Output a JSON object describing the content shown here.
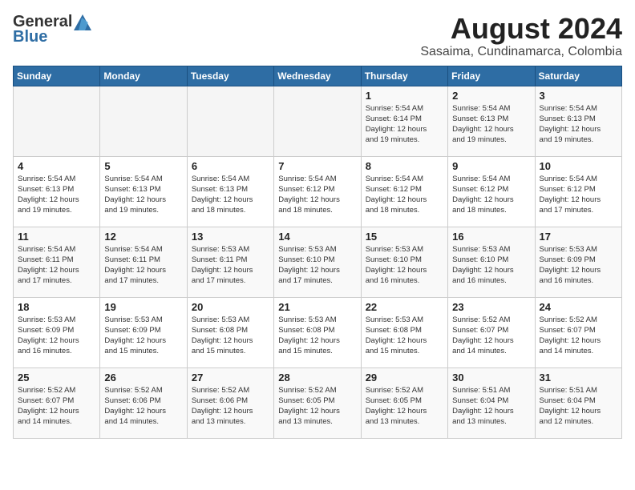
{
  "header": {
    "logo_line1": "General",
    "logo_line2": "Blue",
    "title": "August 2024",
    "subtitle": "Sasaima, Cundinamarca, Colombia"
  },
  "weekdays": [
    "Sunday",
    "Monday",
    "Tuesday",
    "Wednesday",
    "Thursday",
    "Friday",
    "Saturday"
  ],
  "weeks": [
    [
      {
        "day": "",
        "info": ""
      },
      {
        "day": "",
        "info": ""
      },
      {
        "day": "",
        "info": ""
      },
      {
        "day": "",
        "info": ""
      },
      {
        "day": "1",
        "info": "Sunrise: 5:54 AM\nSunset: 6:14 PM\nDaylight: 12 hours\nand 19 minutes."
      },
      {
        "day": "2",
        "info": "Sunrise: 5:54 AM\nSunset: 6:13 PM\nDaylight: 12 hours\nand 19 minutes."
      },
      {
        "day": "3",
        "info": "Sunrise: 5:54 AM\nSunset: 6:13 PM\nDaylight: 12 hours\nand 19 minutes."
      }
    ],
    [
      {
        "day": "4",
        "info": "Sunrise: 5:54 AM\nSunset: 6:13 PM\nDaylight: 12 hours\nand 19 minutes."
      },
      {
        "day": "5",
        "info": "Sunrise: 5:54 AM\nSunset: 6:13 PM\nDaylight: 12 hours\nand 19 minutes."
      },
      {
        "day": "6",
        "info": "Sunrise: 5:54 AM\nSunset: 6:13 PM\nDaylight: 12 hours\nand 18 minutes."
      },
      {
        "day": "7",
        "info": "Sunrise: 5:54 AM\nSunset: 6:12 PM\nDaylight: 12 hours\nand 18 minutes."
      },
      {
        "day": "8",
        "info": "Sunrise: 5:54 AM\nSunset: 6:12 PM\nDaylight: 12 hours\nand 18 minutes."
      },
      {
        "day": "9",
        "info": "Sunrise: 5:54 AM\nSunset: 6:12 PM\nDaylight: 12 hours\nand 18 minutes."
      },
      {
        "day": "10",
        "info": "Sunrise: 5:54 AM\nSunset: 6:12 PM\nDaylight: 12 hours\nand 17 minutes."
      }
    ],
    [
      {
        "day": "11",
        "info": "Sunrise: 5:54 AM\nSunset: 6:11 PM\nDaylight: 12 hours\nand 17 minutes."
      },
      {
        "day": "12",
        "info": "Sunrise: 5:54 AM\nSunset: 6:11 PM\nDaylight: 12 hours\nand 17 minutes."
      },
      {
        "day": "13",
        "info": "Sunrise: 5:53 AM\nSunset: 6:11 PM\nDaylight: 12 hours\nand 17 minutes."
      },
      {
        "day": "14",
        "info": "Sunrise: 5:53 AM\nSunset: 6:10 PM\nDaylight: 12 hours\nand 17 minutes."
      },
      {
        "day": "15",
        "info": "Sunrise: 5:53 AM\nSunset: 6:10 PM\nDaylight: 12 hours\nand 16 minutes."
      },
      {
        "day": "16",
        "info": "Sunrise: 5:53 AM\nSunset: 6:10 PM\nDaylight: 12 hours\nand 16 minutes."
      },
      {
        "day": "17",
        "info": "Sunrise: 5:53 AM\nSunset: 6:09 PM\nDaylight: 12 hours\nand 16 minutes."
      }
    ],
    [
      {
        "day": "18",
        "info": "Sunrise: 5:53 AM\nSunset: 6:09 PM\nDaylight: 12 hours\nand 16 minutes."
      },
      {
        "day": "19",
        "info": "Sunrise: 5:53 AM\nSunset: 6:09 PM\nDaylight: 12 hours\nand 15 minutes."
      },
      {
        "day": "20",
        "info": "Sunrise: 5:53 AM\nSunset: 6:08 PM\nDaylight: 12 hours\nand 15 minutes."
      },
      {
        "day": "21",
        "info": "Sunrise: 5:53 AM\nSunset: 6:08 PM\nDaylight: 12 hours\nand 15 minutes."
      },
      {
        "day": "22",
        "info": "Sunrise: 5:53 AM\nSunset: 6:08 PM\nDaylight: 12 hours\nand 15 minutes."
      },
      {
        "day": "23",
        "info": "Sunrise: 5:52 AM\nSunset: 6:07 PM\nDaylight: 12 hours\nand 14 minutes."
      },
      {
        "day": "24",
        "info": "Sunrise: 5:52 AM\nSunset: 6:07 PM\nDaylight: 12 hours\nand 14 minutes."
      }
    ],
    [
      {
        "day": "25",
        "info": "Sunrise: 5:52 AM\nSunset: 6:07 PM\nDaylight: 12 hours\nand 14 minutes."
      },
      {
        "day": "26",
        "info": "Sunrise: 5:52 AM\nSunset: 6:06 PM\nDaylight: 12 hours\nand 14 minutes."
      },
      {
        "day": "27",
        "info": "Sunrise: 5:52 AM\nSunset: 6:06 PM\nDaylight: 12 hours\nand 13 minutes."
      },
      {
        "day": "28",
        "info": "Sunrise: 5:52 AM\nSunset: 6:05 PM\nDaylight: 12 hours\nand 13 minutes."
      },
      {
        "day": "29",
        "info": "Sunrise: 5:52 AM\nSunset: 6:05 PM\nDaylight: 12 hours\nand 13 minutes."
      },
      {
        "day": "30",
        "info": "Sunrise: 5:51 AM\nSunset: 6:04 PM\nDaylight: 12 hours\nand 13 minutes."
      },
      {
        "day": "31",
        "info": "Sunrise: 5:51 AM\nSunset: 6:04 PM\nDaylight: 12 hours\nand 12 minutes."
      }
    ]
  ]
}
